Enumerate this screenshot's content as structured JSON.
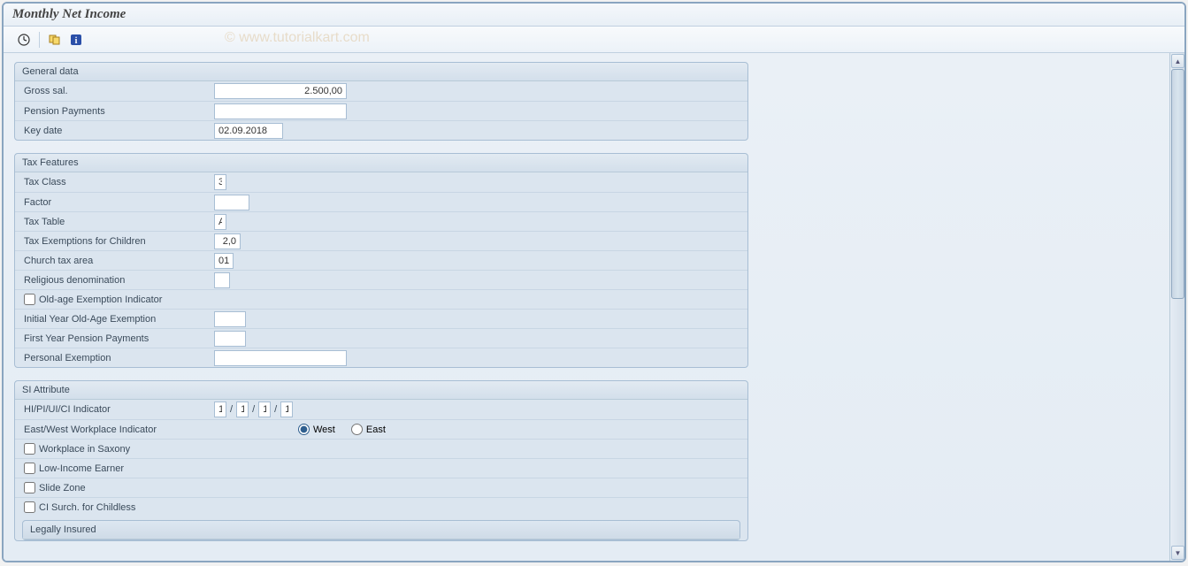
{
  "window": {
    "title": "Monthly Net Income"
  },
  "watermark": "© www.tutorialkart.com",
  "general": {
    "title": "General data",
    "gross_label": "Gross sal.",
    "gross_value": "2.500,00",
    "pension_label": "Pension Payments",
    "pension_value": "",
    "keydate_label": "Key date",
    "keydate_value": "02.09.2018"
  },
  "tax": {
    "title": "Tax Features",
    "class_label": "Tax Class",
    "class_value": "3",
    "factor_label": "Factor",
    "factor_value": "",
    "table_label": "Tax Table",
    "table_value": "A",
    "exempt_children_label": "Tax Exemptions for Children",
    "exempt_children_value": "2,0",
    "church_area_label": "Church tax area",
    "church_area_value": "01",
    "religion_label": "Religious denomination",
    "religion_value": "",
    "oldage_label": "Old-age Exemption Indicator",
    "init_year_oldage_label": "Initial Year Old-Age Exemption",
    "init_year_oldage_value": "",
    "first_year_pension_label": "First Year Pension Payments",
    "first_year_pension_value": "",
    "personal_exempt_label": "Personal Exemption",
    "personal_exempt_value": ""
  },
  "si": {
    "title": "SI Attribute",
    "indicator_label": "HI/PI/UI/CI Indicator",
    "hi": "1",
    "pi": "1",
    "ui": "1",
    "ci": "1",
    "eastwest_label": "East/West Workplace Indicator",
    "west": "West",
    "east": "East",
    "saxony_label": "Workplace in Saxony",
    "lowincome_label": "Low-Income Earner",
    "slidezone_label": "Slide Zone",
    "childless_label": "CI Surch. for Childless",
    "legally_insured_title": "Legally Insured"
  }
}
